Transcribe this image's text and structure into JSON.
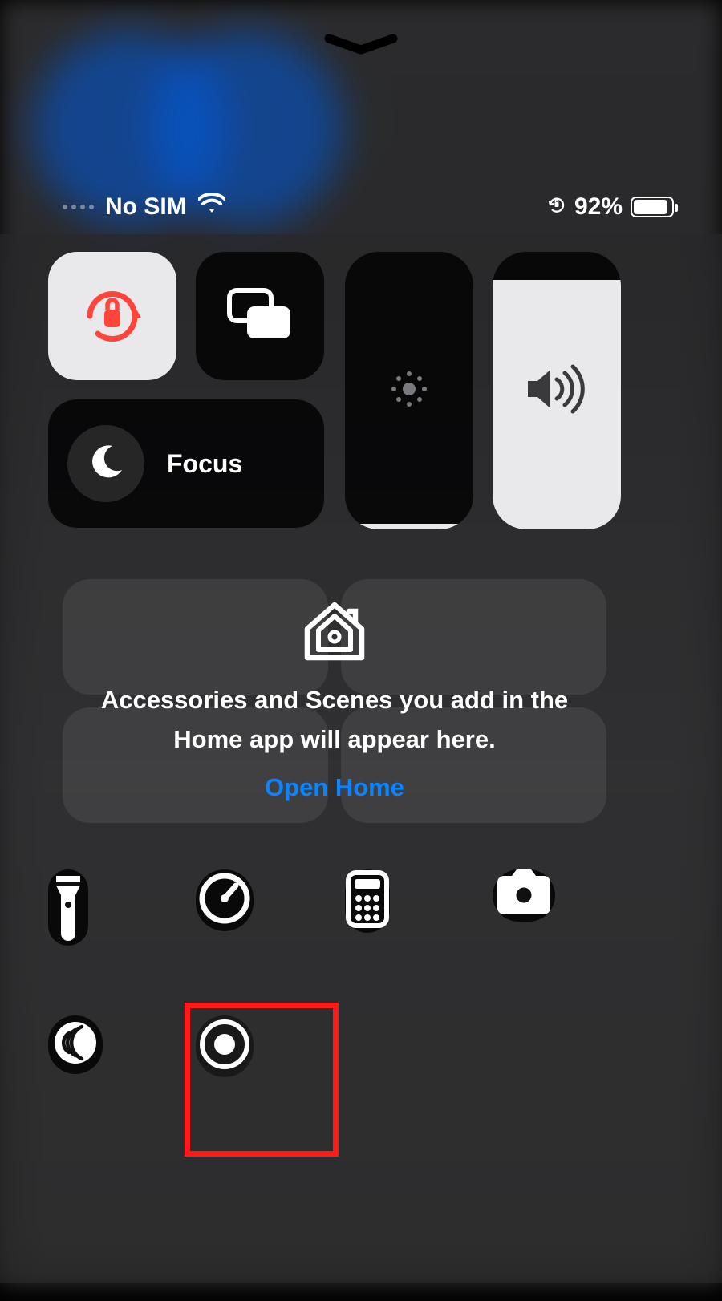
{
  "status": {
    "carrier_text": "No SIM",
    "battery_text": "92%",
    "battery_fill_percent": 92
  },
  "controls": {
    "focus_label": "Focus",
    "brightness_percent": 2,
    "volume_percent": 90
  },
  "home_card": {
    "message": "Accessories and Scenes you add in the Home app will appear here.",
    "link_label": "Open Home"
  },
  "icons": {
    "orientation_lock": "orientation-lock-icon",
    "screen_mirroring": "screen-mirroring-icon",
    "brightness": "brightness-icon",
    "volume": "speaker-icon",
    "focus_moon": "moon-icon",
    "home": "home-icon",
    "flashlight": "flashlight-icon",
    "timer": "timer-icon",
    "calculator": "calculator-icon",
    "camera": "camera-icon",
    "nfc": "nfc-tag-reader-icon",
    "screen_record": "screen-record-icon",
    "wifi": "wifi-icon",
    "rotation_lock_status": "rotation-lock-status-icon"
  },
  "highlight": {
    "target": "screen-record-button"
  },
  "colors": {
    "accent_blue": "#0a84ff",
    "orientation_red": "#ff453a",
    "highlight_red": "#ff1a1a"
  }
}
